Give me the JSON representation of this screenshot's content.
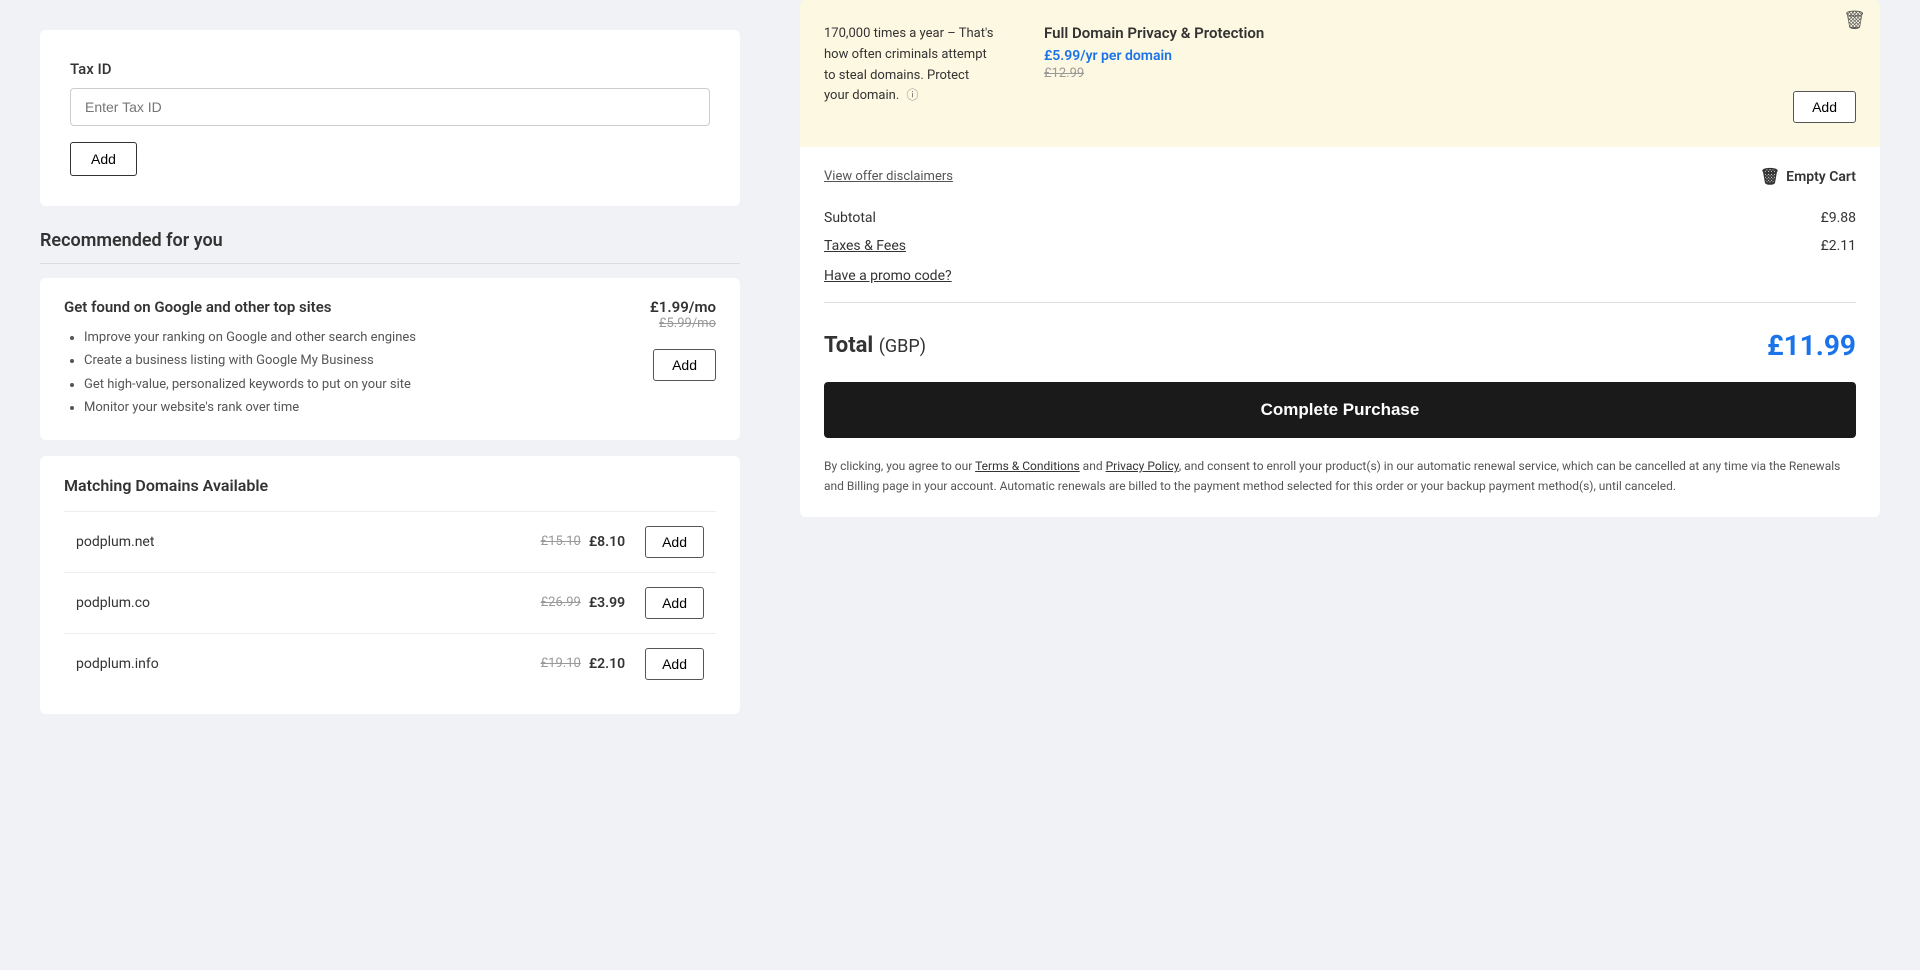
{
  "left": {
    "tax_section": {
      "label": "Tax ID",
      "input_placeholder": "Enter Tax ID",
      "add_button": "Add"
    },
    "recommended": {
      "title": "Recommended for you",
      "item": {
        "title": "Get found on Google and other top sites",
        "price_current": "£1.99/mo",
        "price_original": "£5.99/mo",
        "features": [
          "Improve your ranking on Google and other search engines",
          "Create a business listing with Google My Business",
          "Get high-value, personalized keywords to put on your site",
          "Monitor your website's rank over time"
        ],
        "add_button": "Add"
      }
    },
    "matching": {
      "title": "Matching Domains Available",
      "domains": [
        {
          "name": "podplum.net",
          "price_original": "£15.10",
          "price_current": "£8.10"
        },
        {
          "name": "podplum.co",
          "price_original": "£26.99",
          "price_current": "£3.99"
        },
        {
          "name": "podplum.info",
          "price_original": "£19.10",
          "price_current": "£2.10"
        }
      ],
      "add_button": "Add"
    }
  },
  "right": {
    "privacy_card": {
      "left_text": "170,000 times a year – That's how often criminals attempt to steal domains. Protect your domain.",
      "product_title": "Full Domain Privacy & Protection",
      "price_current": "£5.99/yr per domain",
      "price_original": "£12.99",
      "add_button": "Add"
    },
    "view_disclaimers": "View offer disclaimers",
    "empty_cart": "Empty Cart",
    "subtotal_label": "Subtotal",
    "subtotal_value": "£9.88",
    "taxes_fees_label": "Taxes & Fees",
    "taxes_fees_value": "£2.11",
    "promo_label": "Have a promo code?",
    "total_label": "Total",
    "total_currency": "(GBP)",
    "total_amount": "£11.99",
    "complete_purchase_button": "Complete Purchase",
    "legal_text": "By clicking, you agree to our ",
    "legal_terms": "Terms & Conditions",
    "legal_and": " and ",
    "legal_privacy": "Privacy Policy",
    "legal_rest": ", and consent to enroll your product(s) in our automatic renewal service, which can be cancelled at any time via the Renewals and Billing page in your account. Automatic renewals are billed to the payment method selected for this order or your backup payment method(s), until canceled."
  }
}
